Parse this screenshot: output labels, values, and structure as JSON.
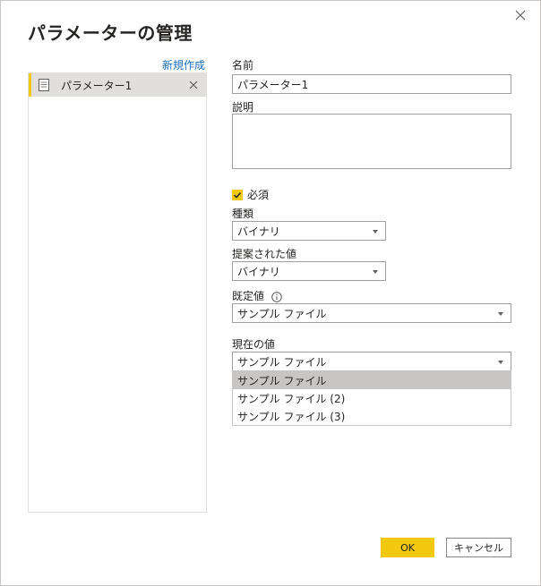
{
  "dialog": {
    "title": "パラメーターの管理",
    "new_label": "新規作成"
  },
  "params_list": [
    {
      "label": "パラメーター1"
    }
  ],
  "form": {
    "name_label": "名前",
    "name_value": "パラメーター1",
    "description_label": "説明",
    "description_value": "",
    "required_label": "必須",
    "required_checked": true,
    "type_label": "種類",
    "type_value": "バイナリ",
    "suggested_label": "提案された値",
    "suggested_value": "バイナリ",
    "default_label": "既定値",
    "default_value": "サンプル ファイル",
    "current_label": "現在の値",
    "current_value": "サンプル ファイル",
    "current_options": [
      "サンプル ファイル",
      "サンプル ファイル (2)",
      "サンプル ファイル (3)"
    ]
  },
  "buttons": {
    "ok": "OK",
    "cancel": "キャンセル"
  },
  "icons": {
    "close": "close-icon",
    "document": "document-icon",
    "delete": "delete-icon",
    "checkmark": "checkmark-icon",
    "caret": "chevron-down-icon",
    "info": "info-icon"
  },
  "colors": {
    "accent": "#f2c811",
    "link": "#1b6ec2",
    "selection": "#c8c6c4"
  }
}
